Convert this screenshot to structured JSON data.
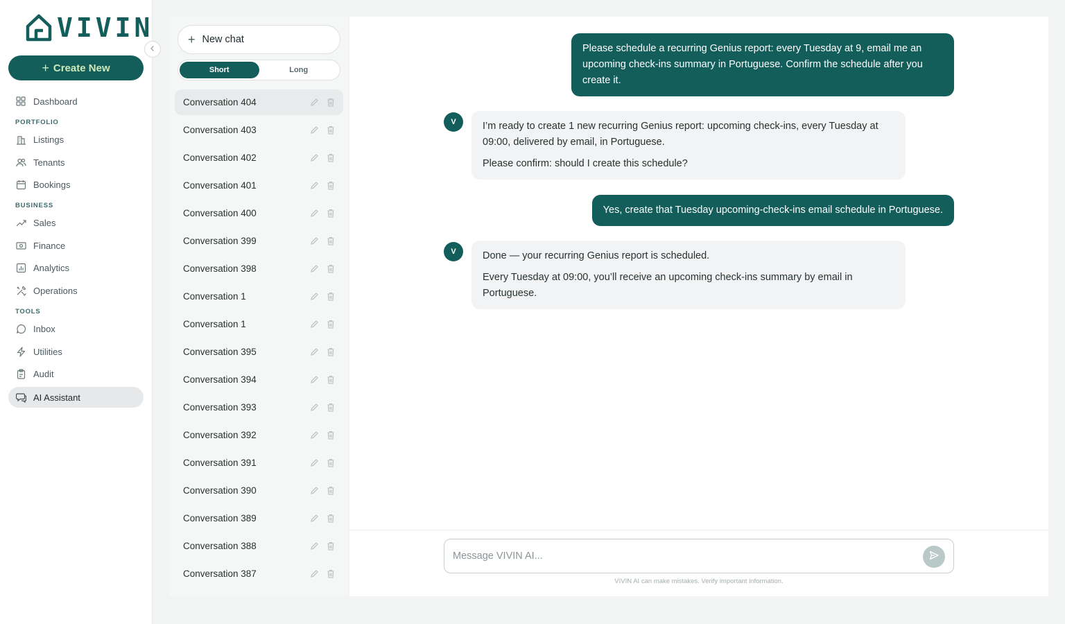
{
  "brand": {
    "name": "VIVIN",
    "accent": "#135e5b"
  },
  "sidebar": {
    "create_label": "Create New",
    "items": [
      {
        "label": "Dashboard",
        "icon": "grid-icon"
      },
      {
        "section": "PORTFOLIO"
      },
      {
        "label": "Listings",
        "icon": "building-icon"
      },
      {
        "label": "Tenants",
        "icon": "users-icon"
      },
      {
        "label": "Bookings",
        "icon": "calendar-icon"
      },
      {
        "section": "BUSINESS"
      },
      {
        "label": "Sales",
        "icon": "trend-icon"
      },
      {
        "label": "Finance",
        "icon": "money-icon"
      },
      {
        "label": "Analytics",
        "icon": "bar-chart-icon"
      },
      {
        "label": "Operations",
        "icon": "tools-icon"
      },
      {
        "section": "TOOLS"
      },
      {
        "label": "Inbox",
        "icon": "chat-icon"
      },
      {
        "label": "Utilities",
        "icon": "bolt-icon"
      },
      {
        "label": "Audit",
        "icon": "clipboard-icon"
      },
      {
        "label": "AI Assistant",
        "icon": "ai-chat-icon",
        "active": true
      }
    ]
  },
  "conversations": {
    "new_chat_label": "New chat",
    "toggle": {
      "short": "Short",
      "long": "Long",
      "selected": "Short"
    },
    "items": [
      "Conversation 404",
      "Conversation 403",
      "Conversation 402",
      "Conversation 401",
      "Conversation 400",
      "Conversation 399",
      "Conversation 398",
      "Conversation 1",
      "Conversation 1",
      "Conversation 395",
      "Conversation 394",
      "Conversation 393",
      "Conversation 392",
      "Conversation 391",
      "Conversation 390",
      "Conversation 389",
      "Conversation 388",
      "Conversation 387"
    ],
    "selected_index": 0
  },
  "chat": {
    "messages": [
      {
        "role": "user",
        "text": "Please schedule a recurring Genius report: every Tuesday at 9, email me an upcoming check-ins summary in Portuguese. Confirm the schedule after you create it."
      },
      {
        "role": "assistant",
        "avatar": "V",
        "paragraphs": [
          "I’m ready to create 1 new recurring Genius report: upcoming check-ins, every Tuesday at 09:00, delivered by email, in Portuguese.",
          "Please confirm: should I create this schedule?"
        ]
      },
      {
        "role": "user",
        "text": "Yes, create that Tuesday upcoming-check-ins email schedule in Portuguese."
      },
      {
        "role": "assistant",
        "avatar": "V",
        "paragraphs": [
          "Done — your recurring Genius report is scheduled.",
          "Every Tuesday at 09:00, you’ll receive an upcoming check-ins summary by email in Portuguese."
        ]
      }
    ],
    "composer": {
      "placeholder": "Message VIVIN AI...",
      "value": ""
    },
    "disclaimer": "VIVIN AI can make mistakes. Verify important information."
  }
}
